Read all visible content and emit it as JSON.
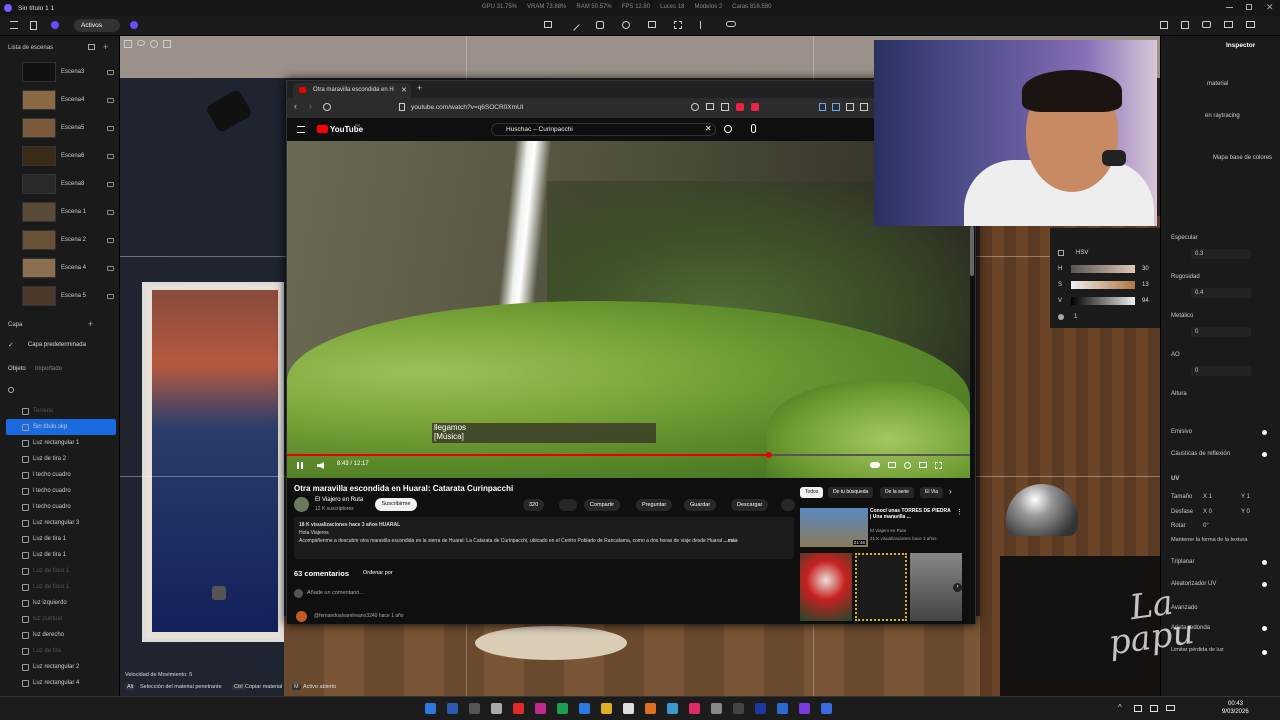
{
  "window": {
    "title": "Sin título 1 1",
    "active_label": "Activos"
  },
  "stats": {
    "gpu": "GPU 31.75%",
    "vram": "VRAM 73.88%",
    "ram": "RAM 50.57%",
    "fps": "FPS 12.80",
    "lights": "Luces 18",
    "models": "Modelos 2",
    "faces": "Caras 816.580"
  },
  "scenes": {
    "header": "Lista de escenas",
    "items": [
      {
        "label": "Escena3"
      },
      {
        "label": "Escena4"
      },
      {
        "label": "Escena5"
      },
      {
        "label": "Escena6"
      },
      {
        "label": "Escena8"
      },
      {
        "label": "Escena 1"
      },
      {
        "label": "Escena 2"
      },
      {
        "label": "Escena 4"
      },
      {
        "label": "Escena 5"
      }
    ]
  },
  "layers": {
    "header": "Capa",
    "default": "Capa predeterminada"
  },
  "objects": {
    "tab_object": "Objeto",
    "tab_imported": "Importado",
    "items": [
      {
        "label": "Terreno",
        "dim": true
      },
      {
        "label": "Sin título.skp",
        "selected": true
      },
      {
        "label": "Luz rectangular 1"
      },
      {
        "label": "Luz de tira 2"
      },
      {
        "label": "l techo cuadro"
      },
      {
        "label": "l techo cuadro"
      },
      {
        "label": "l techo cuadro"
      },
      {
        "label": "Luz rectangular 3"
      },
      {
        "label": "Luz de tira 1"
      },
      {
        "label": "Luz de tira 1"
      },
      {
        "label": "Luz de foco 1",
        "dim": true
      },
      {
        "label": "Luz de foco 1",
        "dim": true
      },
      {
        "label": "luz izquierdo"
      },
      {
        "label": "luz puntual",
        "dim": true
      },
      {
        "label": "luz derecho"
      },
      {
        "label": "Luz de tira",
        "dim": true
      },
      {
        "label": "Luz rectangular 2"
      },
      {
        "label": "Luz rectangular 4"
      }
    ]
  },
  "browser": {
    "tab_title": "Otra maravilla escondida en H",
    "url": "youtube.com/watch?v=q6SOCR0XmUI",
    "search_value": "Huschac – Curinpacchi",
    "logo": "YouTube",
    "logo_region": "PE",
    "caption_line1": "llegamos",
    "caption_line2": "[Música]",
    "time": "8:43 / 12:17",
    "progress": 0.705,
    "video_title": "Otra maravilla escondida en Huaral: Catarata Curinpacchi",
    "channel": "El Viajero en Ruta",
    "subscribers": "12 K suscriptores",
    "subscribe": "Suscribirme",
    "likes": "320",
    "share": "Compartir",
    "ask": "Preguntar",
    "save": "Guardar",
    "download": "Descargar",
    "desc_stats": "18 K visualizaciones  hace 3 años  HUARAL",
    "desc_hello": "Hola Viajeros",
    "desc_text": "Acompáñenme a descubrir otra maravilla escondida en la sierra de Huaral: La Catarata de Curinpacchi, ubicado en el Centro Poblado de Rancatama, como a dos horas de viaje desde Huaral",
    "desc_more": "...más",
    "comments": "63 comentarios",
    "sort": "Ordenar por",
    "add_comment": "Añade un comentario...",
    "first_comment_author": "@fernandoalvarelreano3240  hace 1 año",
    "chips": [
      "Todos",
      "De tu búsqueda",
      "De la serie",
      "El Via"
    ],
    "related_title": "Conocí unas TORRES DE PIEDRA | Una maravilla ...",
    "related_channel": "El Viajero en Ruta",
    "related_stats": "21 K visualizaciones  hace 3 años",
    "related_duration": "21:46"
  },
  "inspector": {
    "tab": "Inspector",
    "material": "material",
    "raytracing": "en raytracing",
    "base_map": "Mapa base de colores",
    "mode": "HSV",
    "h_label": "H",
    "h": "30",
    "s_label": "S",
    "s": "13",
    "v_label": "V",
    "v": "94",
    "opacity": "1",
    "specular_label": "Especular",
    "specular": "0.3",
    "roughness_label": "Rugosidad",
    "roughness": "0.4",
    "metallic_label": "Metálico",
    "metallic": "0",
    "ao_label": "AO",
    "ao": "0",
    "height_label": "Altura",
    "emissive": "Emisivo",
    "caustics": "Cáusticas de reflexión",
    "uv": "UV",
    "size": "Tamaño",
    "size_x": "X 1",
    "size_y": "Y 1",
    "offset": "Desfase",
    "offset_x": "X 0",
    "offset_y": "Y 0",
    "rotate": "Rotar",
    "rotate_val": "0°",
    "keep_shape": "Mantener la forma de la textura",
    "triplanar": "Triplanar",
    "random_uv": "Aleatorizador UV",
    "advanced": "Avanzado",
    "rounded": "Arista redonda",
    "light_loss": "Limitar pérdida de luz"
  },
  "status": {
    "speed": "Velocidad de Movimiento: 5",
    "alt_key": "Alt",
    "alt": "Selección del material penetrante",
    "ctrl_key": "Ctrl",
    "ctrl": "Copiar material",
    "m_key": "M",
    "m": "Activo abierto"
  },
  "taskbar": {
    "time": "00:43",
    "date": "9/03/2026"
  },
  "watermark": {
    "line1": "La",
    "line2": "papu"
  }
}
